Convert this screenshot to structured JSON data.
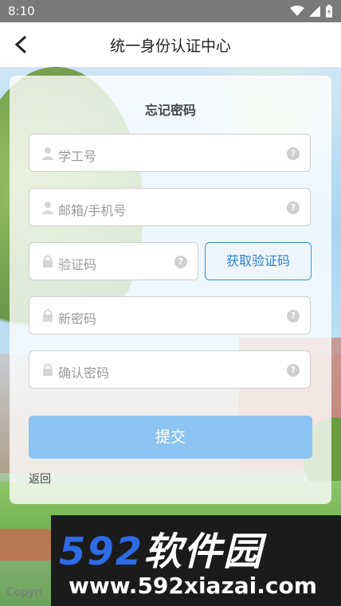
{
  "status_bar": {
    "time": "8:10"
  },
  "header": {
    "title": "统一身份认证中心"
  },
  "form": {
    "title": "忘记密码",
    "fields": [
      {
        "placeholder": "学工号",
        "icon": "user-icon"
      },
      {
        "placeholder": "邮箱/手机号",
        "icon": "user-icon"
      },
      {
        "placeholder": "验证码",
        "icon": "lock-icon"
      },
      {
        "placeholder": "新密码",
        "icon": "lock-icon"
      },
      {
        "placeholder": "确认密码",
        "icon": "lock-icon"
      }
    ],
    "help_glyph": "?",
    "get_code_label": "获取验证码",
    "submit_label": "提交",
    "back_label": "返回"
  },
  "footer": {
    "copyright_fragment": "Copyri"
  },
  "watermark": {
    "logo_digits": "592",
    "logo_text": "软件园",
    "url": "www.592xiazai.com"
  },
  "colors": {
    "accent": "#2f82cf",
    "submit_bg": "#8cc4f4",
    "watermark_blue": "#2e6be6"
  }
}
